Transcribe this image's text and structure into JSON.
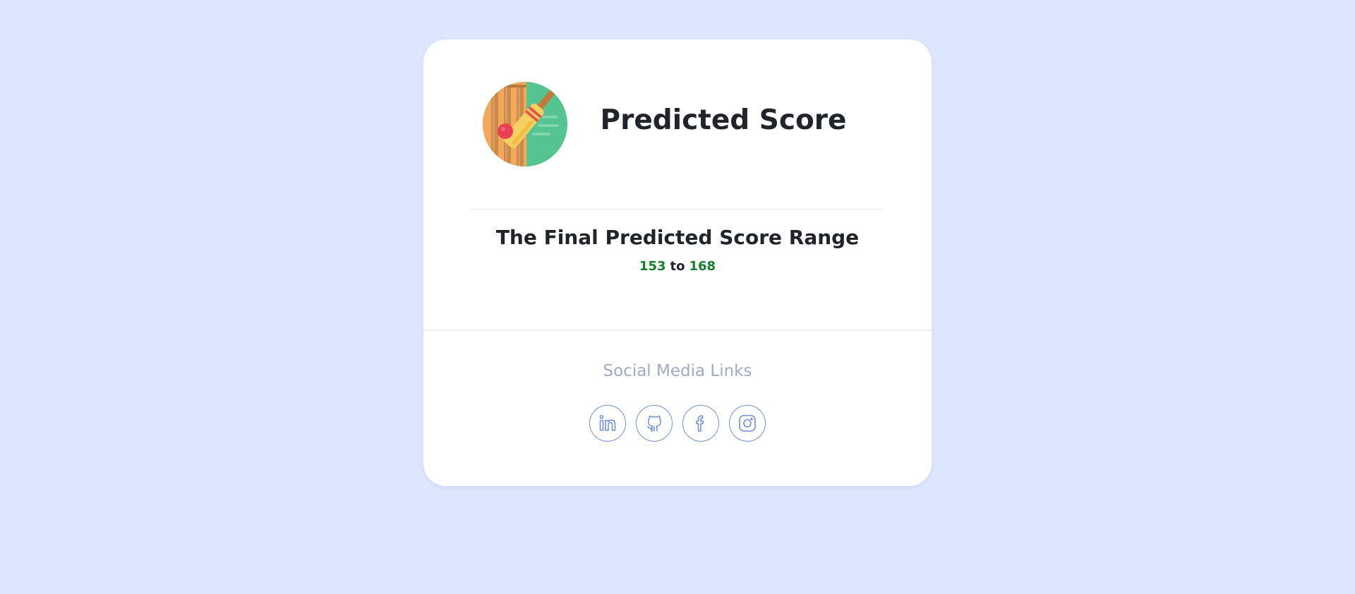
{
  "card": {
    "logo_icon": "cricket-bat-ball-wickets-icon",
    "title": "Predicted Score"
  },
  "result": {
    "heading": "The Final Predicted Score Range",
    "low": "153",
    "separator": "to",
    "high": "168"
  },
  "social": {
    "title": "Social Media Links",
    "links": [
      {
        "name": "linkedin",
        "icon": "linkedin-icon"
      },
      {
        "name": "github",
        "icon": "github-icon"
      },
      {
        "name": "facebook",
        "icon": "facebook-icon"
      },
      {
        "name": "instagram",
        "icon": "instagram-icon"
      }
    ]
  },
  "colors": {
    "background": "#dce6fd",
    "card": "#ffffff",
    "score_green": "#15802a",
    "social_accent": "#6f8fdc",
    "social_title": "#a0aac4"
  }
}
